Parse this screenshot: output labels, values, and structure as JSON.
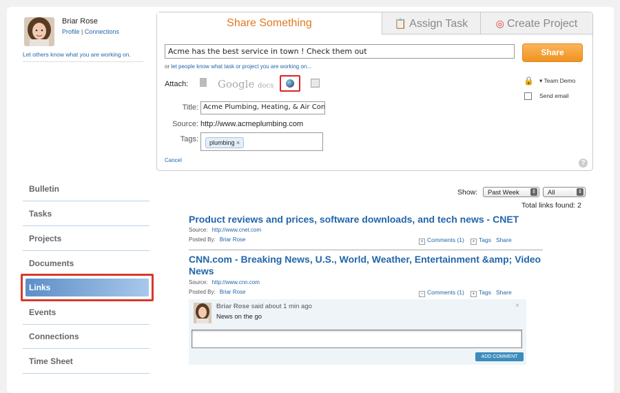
{
  "profile": {
    "name": "Briar Rose",
    "profile_link": "Profile",
    "separator": "|",
    "connections_link": "Connections",
    "status_prompt": "Let others know what you are working on."
  },
  "share": {
    "tabs": {
      "share": "Share Something",
      "assign": "Assign Task",
      "create": "Create Project"
    },
    "message": "Acme has the best service in town ! Check them out",
    "share_button": "Share",
    "or_prefix": "or",
    "or_link": "let people know what task or project you are working on...",
    "attach_label": "Attach:",
    "google_docs": "Google",
    "google_docs_suffix": "docs",
    "privacy": "Team Demo",
    "send_email": "Send email",
    "title_label": "Title:",
    "title_value": "Acme Plumbing, Heating, & Air Condi",
    "source_label": "Source:",
    "source_value": "http://www.acmeplumbing.com",
    "tags_label": "Tags:",
    "tag": "plumbing",
    "cancel": "Cancel",
    "help": "?"
  },
  "sidebar": {
    "items": [
      "Bulletin",
      "Tasks",
      "Projects",
      "Documents",
      "Links",
      "Events",
      "Connections",
      "Time Sheet"
    ],
    "active": "Links"
  },
  "links": {
    "show_label": "Show:",
    "period": "Past Week",
    "filter": "All",
    "total": "Total links found: 2",
    "items": [
      {
        "title": "Product reviews and prices, software downloads, and tech news - CNET",
        "source_label": "Source:",
        "source": "http://www.cnet.com",
        "posted_label": "Posted By:",
        "posted_by": "Briar Rose",
        "comments": "Comments (1)",
        "tags": "Tags",
        "share": "Share"
      },
      {
        "title": "CNN.com - Breaking News, U.S., World, Weather, Entertainment &amp; Video News",
        "source_label": "Source:",
        "source": "http://www.cnn.com",
        "posted_label": "Posted By:",
        "posted_by": "Briar Rose",
        "comments": "Comments (1)",
        "tags": "Tags",
        "share": "Share"
      }
    ],
    "comment": {
      "author": "Briar Rose",
      "meta": "said about 1 min ago",
      "text": "News on the go",
      "close": "×",
      "add_button": "ADD COMMENT"
    }
  },
  "colors": {
    "accent_orange": "#f09320",
    "link_blue": "#2266aa",
    "highlight_red": "#d53a2a"
  }
}
